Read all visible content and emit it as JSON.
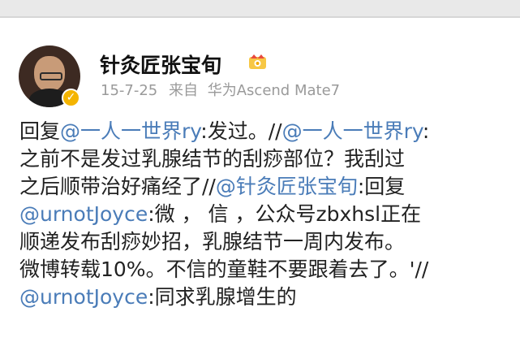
{
  "post": {
    "author": "针灸匠张宝旬",
    "verified_symbol": "✓",
    "date": "15-7-25",
    "source_prefix": "来自",
    "device": "华为Ascend Mate7",
    "line1": {
      "a": "回复",
      "m1": "@一人一世界ry",
      "b": ":发过。//",
      "m2": "@一人一世界ry",
      "c": ":"
    },
    "line2": {
      "a": "之前不是发过乳腺结节的刮痧部位？我刮过"
    },
    "line3": {
      "a": "之后顺带治好痛经了//",
      "m1": "@针灸匠张宝旬",
      "b": ":回复"
    },
    "line4": {
      "m1": "@urnotJoyce",
      "a": ":微 ，  信  ，公众号zbxhsl正在"
    },
    "line5": {
      "a": "顺递发布刮痧妙招，乳腺结节一周内发布。"
    },
    "line6": {
      "a": "微博转载10%。不信的童鞋不要跟着去了。'//"
    },
    "line7": {
      "m1": "@urnotJoyce",
      "a": ":同求乳腺增生的"
    }
  },
  "colors": {
    "mention": "#4a7cb8",
    "badge": "#f4b400",
    "meta": "#9a9a9a"
  }
}
